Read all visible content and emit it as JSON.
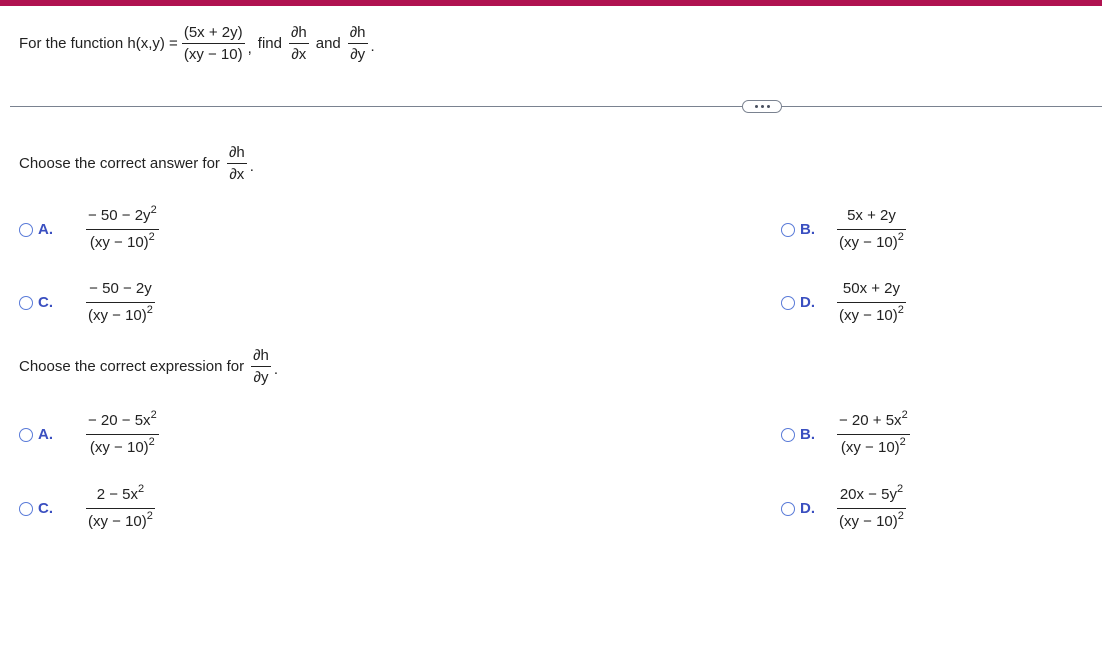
{
  "header": {
    "accent_color": "#b01250"
  },
  "question": {
    "prefix": "For the function h(x,y) =",
    "func_numerator": "(5x + 2y)",
    "func_denominator": "(xy − 10)",
    "comma": ",",
    "find_label": "find",
    "dx_num": "∂h",
    "dx_den": "∂x",
    "and_label": "and",
    "dy_num": "∂h",
    "dy_den": "∂y",
    "period": "."
  },
  "more_button": {
    "icon": "ellipsis-icon"
  },
  "part1": {
    "prompt": "Choose the correct answer for",
    "frac_num": "∂h",
    "frac_den": "∂x",
    "period": ".",
    "options": [
      {
        "letter": "A.",
        "num": "− 50 − 2y",
        "num_sup": "2",
        "den": "(xy − 10)",
        "den_sup": "2"
      },
      {
        "letter": "B.",
        "num": "5x + 2y",
        "num_sup": "",
        "den": "(xy − 10)",
        "den_sup": "2"
      },
      {
        "letter": "C.",
        "num": "− 50 − 2y",
        "num_sup": "",
        "den": "(xy − 10)",
        "den_sup": "2"
      },
      {
        "letter": "D.",
        "num": "50x + 2y",
        "num_sup": "",
        "den": "(xy − 10)",
        "den_sup": "2"
      }
    ]
  },
  "part2": {
    "prompt": "Choose the correct expression for",
    "frac_num": "∂h",
    "frac_den": "∂y",
    "period": ".",
    "options": [
      {
        "letter": "A.",
        "num": "− 20 − 5x",
        "num_sup": "2",
        "den": "(xy − 10)",
        "den_sup": "2"
      },
      {
        "letter": "B.",
        "num": "− 20 + 5x",
        "num_sup": "2",
        "den": "(xy − 10)",
        "den_sup": "2"
      },
      {
        "letter": "C.",
        "num": "2 − 5x",
        "num_sup": "2",
        "den": "(xy − 10)",
        "den_sup": "2"
      },
      {
        "letter": "D.",
        "num": "20x − 5y",
        "num_sup": "2",
        "den": "(xy − 10)",
        "den_sup": "2"
      }
    ]
  }
}
